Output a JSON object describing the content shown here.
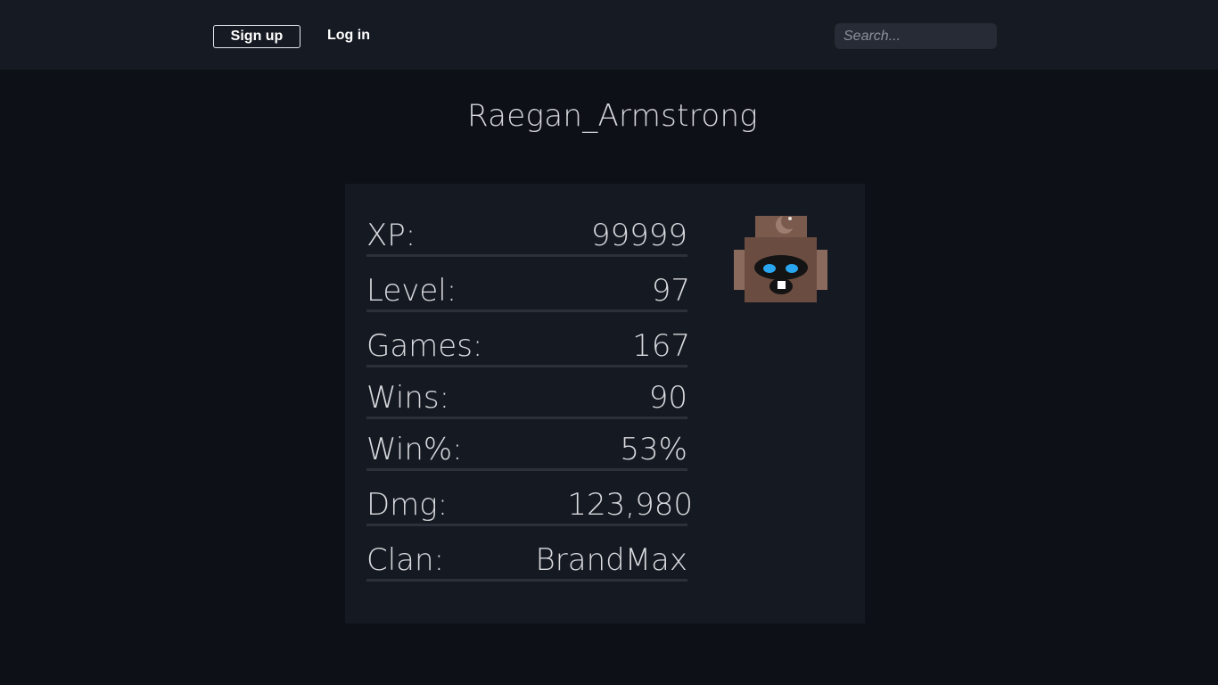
{
  "nav": {
    "signup_label": "Sign up",
    "login_label": "Log in",
    "search_placeholder": "Search..."
  },
  "profile": {
    "username": "Raegan_Armstrong",
    "stats": [
      {
        "label": "XP:",
        "value": "99999"
      },
      {
        "label": "Level:",
        "value": "97"
      },
      {
        "label": "Games:",
        "value": "167"
      },
      {
        "label": "Wins:",
        "value": "90"
      },
      {
        "label": "Win%:",
        "value": "53%"
      },
      {
        "label": "Dmg:",
        "value": "123,980"
      },
      {
        "label": "Clan:",
        "value": "BrandMax"
      }
    ],
    "avatar_icon": "robot-creature-avatar"
  },
  "colors": {
    "page_bg": "#0d1017",
    "topbar_bg": "#161a22",
    "card_bg": "#151921",
    "text": "#d8dade",
    "divider": "#2b303b",
    "avatar_brown": "#6b4c40",
    "avatar_eyes": "#2aa6f0"
  }
}
